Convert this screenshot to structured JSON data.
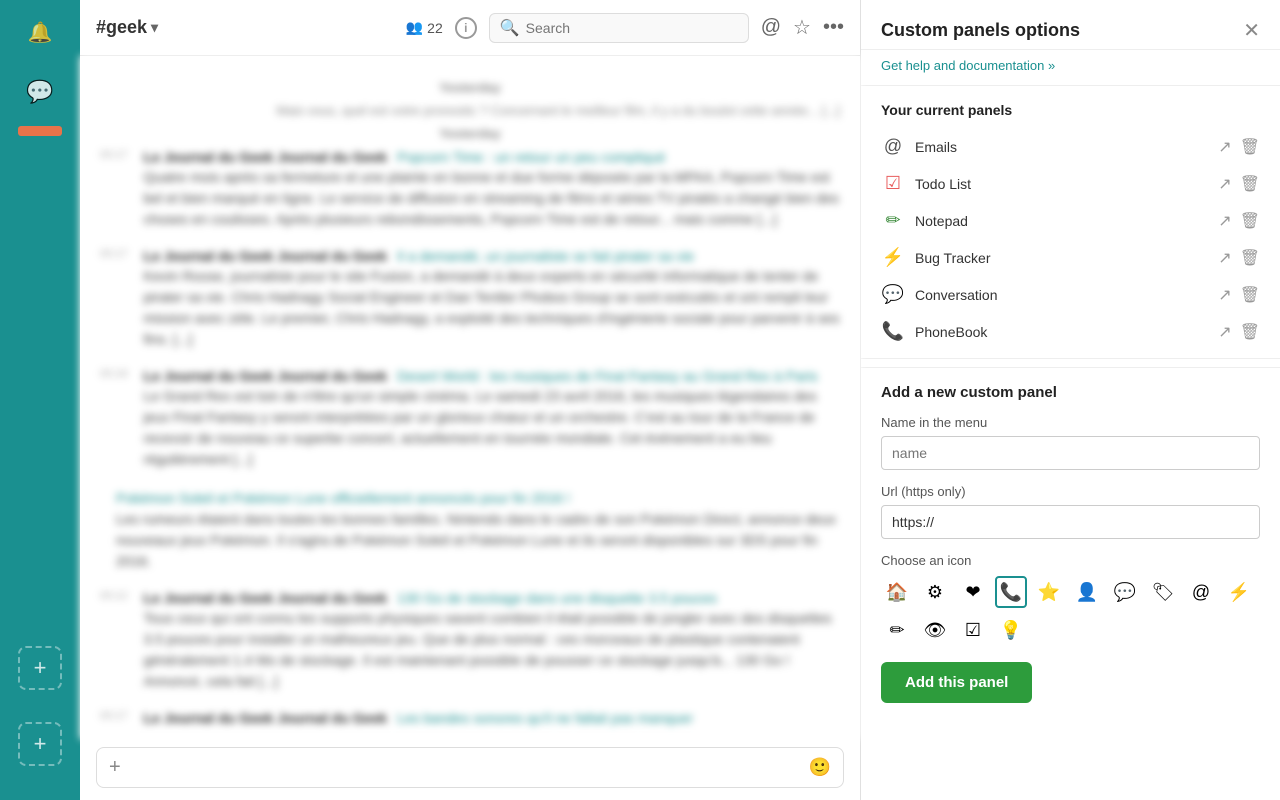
{
  "sidebar": {
    "bell_icon": "🔔",
    "add_icon": "+",
    "items": []
  },
  "topbar": {
    "channel_name": "#geek",
    "members_count": "22",
    "members_icon": "👥",
    "info_label": "i",
    "search_placeholder": "Search",
    "at_icon": "@",
    "star_icon": "☆",
    "more_icon": "•••"
  },
  "messages": [
    {
      "id": "msg1",
      "time": "",
      "author": "Le Journal du Geek Journal du Geek",
      "source": "Popcorn Time : un retour un peu compliqué",
      "text": "Quatre mois après sa fermeture et une plainte en bonne et due forme déposée par la MPAA, Popcorn Time est bel et bien marqué en ligne. Le service de diffusion en streaming de films et séries TV piratés a changé bien des choses en coulisses. Après plusieurs rebondissements, Popcorn Time est de retour... mais comme [...]"
    },
    {
      "id": "msg2",
      "time": "",
      "author": "Le Journal du Geek Journal du Geek",
      "source": "Il a demandé, un journaliste se fait pirater sa vie",
      "text": "Kevin Roose, journaliste pour le site Fusion, a demandé à deux experts en sécurité informatique de tenter de pirater sa vie. Chris Hadnagy Social Engineer et Dan Tentler Phobos Group se sont exécutés et ont rempli leur mission avec zèle. Le premier, Chris Hadnagy, a exploité des techniques d'ingénierie sociale pour parvenir à ses fins. [...]"
    },
    {
      "id": "msg3",
      "time": "",
      "author": "Le Journal du Geek Journal du Geek",
      "source": "Desert World : les musiques de Final Fantasy au Grand Rex à Paris",
      "text": "Le Grand Rex est loin de rêtre qu'un simple cinéma. Le samedi 23 avril 2016, les musiques légendaires des jeux Final Fantasy y seront interprétées par un glorieux chœur et un orchestre. C'est au tour de la France de recevoir de nouveau ce superbe concert, actuellement en tournée mondiale. Cet événement a eu lieu régulièrement [...]"
    },
    {
      "id": "msg4",
      "time": "",
      "author": "",
      "source": "Pokémon Soleil et Pokémon Lune officiellement annoncés pour fin 2016 !",
      "text": "Les rumeurs étaient dans toutes les bonnes familles. Nintendo dans le cadre de son Pokémon Direct, annonce deux nouveaux jeux Pokémon. Il s'agira de Pokémon Soleil et Pokémon Lune et ils seront disponibles sur 3DS pour fin 2016."
    },
    {
      "id": "msg5",
      "time": "",
      "author": "Le Journal du Geek Journal du Geek",
      "source": "130 Go de stockage dans une disquette 3.5 pouces",
      "text": "Tous ceux qui ont connu les supports physiques savent combien il était possible de jongler avec des disquettes 3.5 pouces pour installer un malheureux jeu. Que de plus normal : ces morceaux de plastique contenaient généralement 1.4 Mo de stockage. Il est maintenant possible de pousser ce stockage jusqu'à... 130 Go ! Annoncé, cela fait [...]"
    },
    {
      "id": "msg6",
      "time": "",
      "author": "Le Journal du Geek Journal du Geek",
      "source": "Les bandes sonores qu'il ne fallait pas manquer",
      "text": ""
    }
  ],
  "input_bar": {
    "placeholder": "",
    "plus_icon": "+",
    "emoji_icon": "🙂"
  },
  "right_panel": {
    "title": "Custom panels options",
    "help_link": "Get help and documentation »",
    "current_panels_title": "Your current panels",
    "panels": [
      {
        "id": "emails",
        "icon": "@",
        "label": "Emails",
        "icon_color": "#555"
      },
      {
        "id": "todolist",
        "icon": "☑",
        "label": "Todo List",
        "icon_color": "#e85d5d"
      },
      {
        "id": "notepad",
        "icon": "✏",
        "label": "Notepad",
        "icon_color": "#3a8a3a"
      },
      {
        "id": "bugtracker",
        "icon": "⚡",
        "label": "Bug Tracker",
        "icon_color": "#e8c23a"
      },
      {
        "id": "conversation",
        "icon": "💬",
        "label": "Conversation",
        "icon_color": "#5555cc"
      },
      {
        "id": "phonebook",
        "icon": "📞",
        "label": "PhoneBook",
        "icon_color": "#333"
      }
    ],
    "add_panel_title": "Add a new custom panel",
    "name_label": "Name in the menu",
    "name_placeholder": "name",
    "url_label": "Url (https only)",
    "url_placeholder": "https://",
    "icon_label": "Choose an icon",
    "icons": [
      {
        "id": "home",
        "symbol": "🏠"
      },
      {
        "id": "settings",
        "symbol": "⚙"
      },
      {
        "id": "heart",
        "symbol": "❤"
      },
      {
        "id": "phone",
        "symbol": "📞"
      },
      {
        "id": "star",
        "symbol": "⭐"
      },
      {
        "id": "user",
        "symbol": "👤"
      },
      {
        "id": "chat",
        "symbol": "💬"
      },
      {
        "id": "tag",
        "symbol": "🏷"
      },
      {
        "id": "at",
        "symbol": "@"
      },
      {
        "id": "lightning",
        "symbol": "⚡"
      },
      {
        "id": "pencil",
        "symbol": "✏"
      },
      {
        "id": "eye",
        "symbol": "👁"
      },
      {
        "id": "check",
        "symbol": "☑"
      },
      {
        "id": "bulb",
        "symbol": "💡"
      }
    ],
    "selected_icon": "phone",
    "add_btn_label": "Add this panel"
  }
}
